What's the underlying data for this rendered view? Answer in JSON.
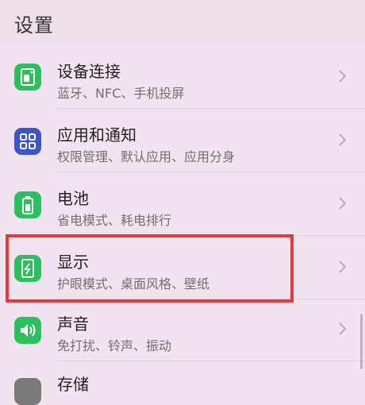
{
  "header": {
    "title": "设置"
  },
  "settings": {
    "items": [
      {
        "title": "设备连接",
        "subtitle": "蓝牙、NFC、手机投屏",
        "icon": "device-connection-icon",
        "color": "#2bbf5d"
      },
      {
        "title": "应用和通知",
        "subtitle": "权限管理、默认应用、应用分身",
        "icon": "apps-grid-icon",
        "color": "#3d55c9"
      },
      {
        "title": "电池",
        "subtitle": "省电模式、耗电排行",
        "icon": "battery-icon",
        "color": "#2bbf5d"
      },
      {
        "title": "显示",
        "subtitle": "护眼模式、桌面风格、壁纸",
        "icon": "display-icon",
        "color": "#2bbf5d"
      },
      {
        "title": "声音",
        "subtitle": "免打扰、铃声、振动",
        "icon": "speaker-icon",
        "color": "#2bbf5d"
      },
      {
        "title": "存储",
        "subtitle": "",
        "icon": "storage-icon",
        "color": "#7a7a7a"
      }
    ]
  },
  "highlight_color": "#e53a3d"
}
